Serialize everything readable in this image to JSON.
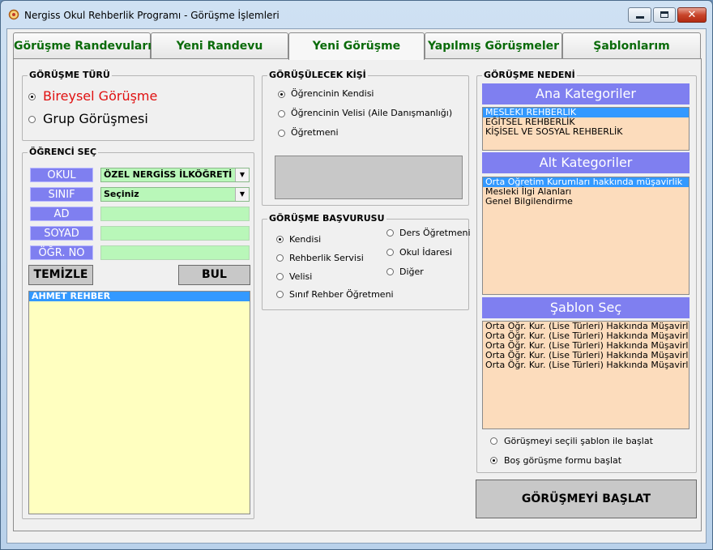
{
  "window": {
    "title": "Nergiss Okul Rehberlik Programı - Görüşme İşlemleri"
  },
  "tabs": [
    {
      "label": "Görüşme Randevuları"
    },
    {
      "label": "Yeni Randevu"
    },
    {
      "label": "Yeni Görüşme"
    },
    {
      "label": "Yapılmış Görüşmeler"
    },
    {
      "label": "Şablonlarım"
    }
  ],
  "gorusme_turu": {
    "title": "GÖRÜŞME TÜRÜ",
    "options": [
      {
        "label": "Bireysel Görüşme",
        "selected": true
      },
      {
        "label": "Grup Görüşmesi",
        "selected": false
      }
    ]
  },
  "ogrenci_sec": {
    "title": "ÖĞRENCİ SEÇ",
    "okul_label": "OKUL",
    "okul_value": "ÖZEL NERGİSS İLKÖĞRETİ",
    "sinif_label": "SINIF",
    "sinif_value": "Seçiniz",
    "ad_label": "AD",
    "soyad_label": "SOYAD",
    "ogr_no_label": "ÖĞR. NO",
    "temizle_label": "TEMİZLE",
    "bul_label": "BUL",
    "students": [
      {
        "name": "AHMET REHBER",
        "selected": true
      }
    ]
  },
  "gorusulecek_kisi": {
    "title": "GÖRÜŞÜLECEK KİŞİ",
    "options": [
      {
        "label": "Öğrencinin Kendisi",
        "selected": true
      },
      {
        "label": "Öğrencinin Velisi (Aile Danışmanlığı)",
        "selected": false
      },
      {
        "label": "Öğretmeni",
        "selected": false
      }
    ]
  },
  "gorusme_basvurusu": {
    "title": "GÖRÜŞME BAŞVURUSU",
    "left_options": [
      {
        "label": "Kendisi",
        "selected": true
      },
      {
        "label": "Rehberlik Servisi",
        "selected": false
      },
      {
        "label": "Velisi",
        "selected": false
      },
      {
        "label": "Sınıf Rehber Öğretmeni",
        "selected": false
      }
    ],
    "right_options": [
      {
        "label": "Ders Öğretmeni",
        "selected": false
      },
      {
        "label": "Okul İdaresi",
        "selected": false
      },
      {
        "label": "Diğer",
        "selected": false
      }
    ]
  },
  "gorusme_nedeni": {
    "title": "GÖRÜŞME NEDENİ",
    "ana_kategoriler_header": "Ana Kategoriler",
    "ana_kategoriler": [
      {
        "label": "MESLEKİ REHBERLİK",
        "selected": true
      },
      {
        "label": "EĞİTSEL REHBERLİK",
        "selected": false
      },
      {
        "label": "KİŞİSEL VE SOSYAL REHBERLİK",
        "selected": false
      }
    ],
    "alt_kategoriler_header": "Alt  Kategoriler",
    "alt_kategoriler": [
      {
        "label": "Orta Öğretim Kurumları hakkında müşavirlik",
        "selected": true
      },
      {
        "label": "Mesleki İlgi Alanları",
        "selected": false
      },
      {
        "label": "Genel Bilgilendirme",
        "selected": false
      }
    ],
    "sablon_sec_header": "Şablon Seç",
    "sablonlar": [
      {
        "label": "Orta Öğr. Kur. (Lise Türleri) Hakkında Müşavirlik (A FO"
      },
      {
        "label": "Orta Öğr. Kur. (Lise Türleri) Hakkında Müşavirlik - (B F"
      },
      {
        "label": "Orta Öğr. Kur. (Lise Türleri) Hakkında Müşavirlik (C FO"
      },
      {
        "label": "Orta Öğr. Kur. (Lise Türleri) Hakkında Müşavirlik (D FO"
      },
      {
        "label": "Orta Öğr. Kur. (Lise Türleri) Hakkında Müşavirlik (E FO"
      }
    ],
    "start_options": [
      {
        "label": "Görüşmeyi seçili şablon ile başlat",
        "selected": false
      },
      {
        "label": "Boş görüşme formu başlat",
        "selected": true
      }
    ]
  },
  "start_button_label": "GÖRÜŞMEYİ BAŞLAT",
  "colors": {
    "accent": "#7f7ff0",
    "field_green": "#b9f7b9",
    "list_peach": "#fcdcbc",
    "list_yellow": "#ffffc0",
    "selection": "#3399ff",
    "tab_text": "#0a6b0a",
    "bireysel_red": "#e01010"
  }
}
